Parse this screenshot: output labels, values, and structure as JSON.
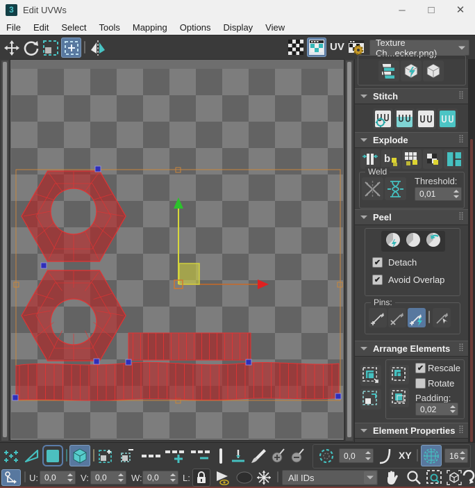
{
  "window": {
    "title": "Edit UVWs",
    "icon_text": "3"
  },
  "menu": {
    "items": [
      "File",
      "Edit",
      "Select",
      "Tools",
      "Mapping",
      "Options",
      "Display",
      "View"
    ]
  },
  "top_toolbar": {
    "uv_label": "UV",
    "texture_dropdown_value": "Texture Ch...ecker.png)"
  },
  "panel": {
    "stitch": {
      "title": "Stitch"
    },
    "explode": {
      "title": "Explode",
      "weld_group_label": "Weld",
      "threshold_label": "Threshold:",
      "threshold_value": "0,01"
    },
    "peel": {
      "title": "Peel",
      "detach_label": "Detach",
      "detach_checked": true,
      "avoid_overlap_label": "Avoid Overlap",
      "avoid_overlap_checked": true
    },
    "pins": {
      "group_label": "Pins:"
    },
    "arrange": {
      "title": "Arrange Elements",
      "rescale_label": "Rescale",
      "rescale_checked": true,
      "rotate_label": "Rotate",
      "rotate_checked": false,
      "padding_label": "Padding:",
      "padding_value": "0,02"
    },
    "element_properties": {
      "title": "Element Properties"
    }
  },
  "bottom_toolbar": {
    "soft_selection_value": "0,0",
    "xy_label": "XY",
    "grid_size_value": "16"
  },
  "transform_row": {
    "u_label": "U:",
    "u_value": "0,0",
    "v_label": "V:",
    "v_value": "0,0",
    "w_label": "W:",
    "w_value": "0,0",
    "l_label": "L:",
    "ids_value": "All IDs"
  },
  "colors": {
    "accent_teal": "#45c0c0",
    "selection_blue": "#58789f",
    "uv_red": "#c23232",
    "bbox_orange": "#c8863c",
    "gizmo_yellow": "#d8d83a",
    "axis_green": "#2cc22c",
    "axis_red": "#e02020"
  }
}
